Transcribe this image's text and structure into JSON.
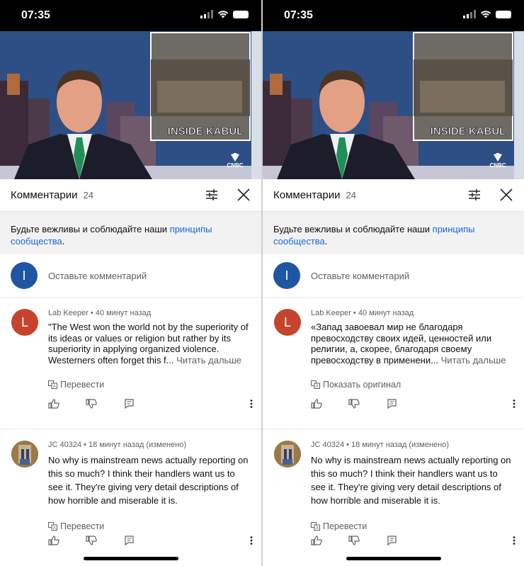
{
  "status": {
    "time": "07:35"
  },
  "video": {
    "overlay_text": "INSIDE KABUL",
    "network_logo": "CNBC"
  },
  "comments_header": {
    "title": "Комментарии",
    "count": "24"
  },
  "notice": {
    "text": "Будьте вежливы и соблюдайте наши ",
    "link": "принципы сообщества",
    "end": "."
  },
  "composer": {
    "avatar_letter": "I",
    "placeholder": "Оставьте комментарий",
    "avatar_color": "#1f56a3"
  },
  "phones": [
    {
      "comments": [
        {
          "avatar_letter": "L",
          "avatar_color": "#c4452c",
          "meta": "Lab Keeper • 40 минут назад",
          "text": "\"The West won the world not by the superiority of its ideas or values or religion but rather by its superiority in applying organized violence. Westerners often forget this f...",
          "read_more": " Читать дальше",
          "translate": "Перевести"
        },
        {
          "avatar_letter": "",
          "meta": "JC 40324 • 18 минут назад (изменено)",
          "text": "No why is mainstream news actually reporting on this so much? I think their handlers want us to see it. They're giving very detail descriptions of how horrible and miserable it is.",
          "read_more": "",
          "translate": "Перевести"
        }
      ]
    },
    {
      "comments": [
        {
          "avatar_letter": "L",
          "avatar_color": "#c4452c",
          "meta": "Lab Keeper • 40 минут назад",
          "text": "«Запад завоевал мир не благодаря превосходству своих идей, ценностей или религии, а, скорее, благодаря своему превосходству в применени...",
          "read_more": " Читать дальше",
          "translate": "Показать оригинал"
        },
        {
          "avatar_letter": "",
          "meta": "JC 40324 • 18 минут назад (изменено)",
          "text": "No why is mainstream news actually reporting on this so much? I think their handlers want us to see it. They're giving very detail descriptions of how horrible and miserable it is.",
          "read_more": "",
          "translate": "Перевести"
        }
      ]
    }
  ]
}
